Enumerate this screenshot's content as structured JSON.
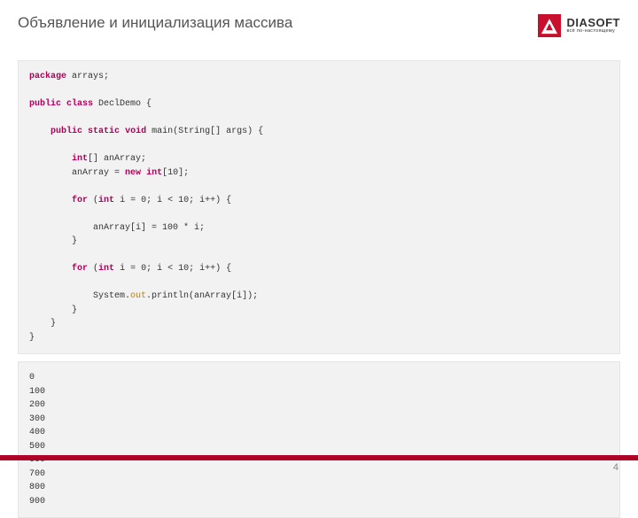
{
  "title": "Объявление и инициализация массива",
  "logo": {
    "brand": "DIASOFT",
    "tagline": "всё по-настоящему"
  },
  "code": {
    "package_kw": "package",
    "package_name": " arrays;",
    "public_kw": "public",
    "class_kw": "class",
    "class_name": " DeclDemo {",
    "static_kw": "static",
    "void_kw": "void",
    "main_sig": " main(String[] args) {",
    "int_kw": "int",
    "decl": "[] anArray;",
    "assign_pre": "        anArray = ",
    "new_kw": "new",
    "assign_post": "[10];",
    "for_kw": "for",
    "for_cond": " i = 0; i < 10; i++) {",
    "loop1_body": "            anArray[i] = 100 * i;",
    "close_brace": "        }",
    "print_pre": "            System.",
    "out_kw": "out",
    "print_post": ".println(anArray[i]);",
    "close2": "        }",
    "close3": "    }",
    "close4": "}"
  },
  "output": "0\n100\n200\n300\n400\n500\n600\n700\n800\n900",
  "page_number": "4"
}
